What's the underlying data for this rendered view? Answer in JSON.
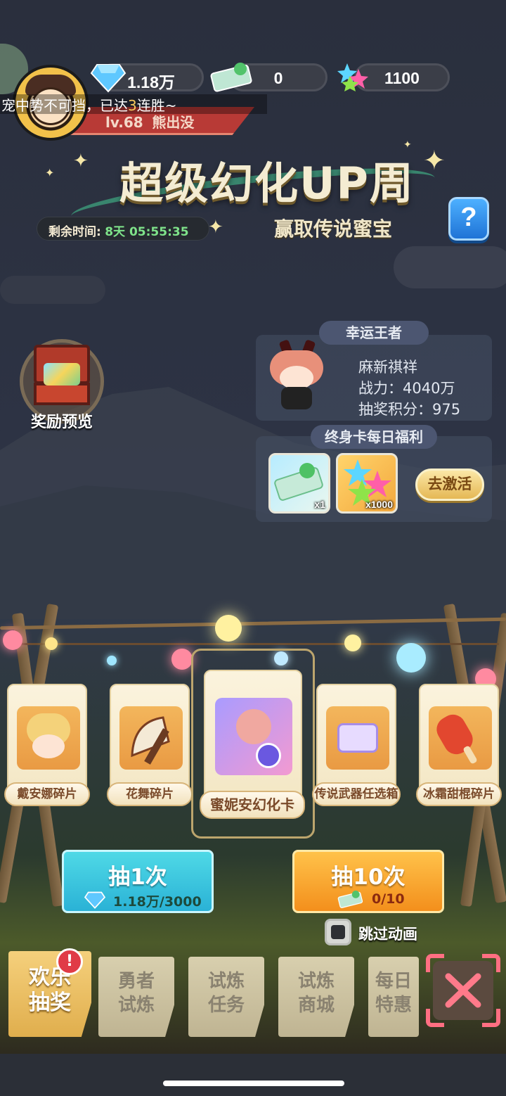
{
  "currency": {
    "diamonds": "1.18万",
    "tickets": "0",
    "stars": "1100"
  },
  "marquee": {
    "pre": "宠中势不可挡，已达",
    "count": "3",
    "post": "连胜~"
  },
  "player": {
    "level": "lv.68",
    "name": "熊出没"
  },
  "event": {
    "title": "超级幻化UP周",
    "subtitle": "赢取传说蜜宝",
    "timer_label": "剩余时间:",
    "timer_value": "8天 05:55:35",
    "help_label": "?"
  },
  "reward_preview": {
    "label": "奖励预览"
  },
  "lucky_king": {
    "tag": "幸运王者",
    "name": "麻新祺祥",
    "power": "战力：4040万",
    "score": "抽奖积分：975"
  },
  "lifetime_card": {
    "tag": "终身卡每日福利",
    "items": [
      {
        "icon": "super-ticket-icon",
        "qty": "x1"
      },
      {
        "icon": "stars-icon",
        "qty": "x1000"
      }
    ],
    "activate_label": "去激活"
  },
  "prize_cards": [
    {
      "label": "戴安娜碎片",
      "icon": "diana-fragment-icon"
    },
    {
      "label": "花舞碎片",
      "icon": "fan-fragment-icon"
    },
    {
      "label": "蜜妮安幻化卡",
      "icon": "transform-card-icon"
    },
    {
      "label": "传说武器任选箱",
      "icon": "weapon-chest-icon"
    },
    {
      "label": "冰霜甜棍碎片",
      "icon": "popsicle-fragment-icon"
    }
  ],
  "draw": {
    "single": {
      "label": "抽1次",
      "cost": "1.18万/3000"
    },
    "ten": {
      "label": "抽10次",
      "cost": "0/10"
    },
    "skip_label": "跳过动画"
  },
  "tabs": [
    {
      "label": "欢乐\n抽奖",
      "active": true
    },
    {
      "label": "勇者\n试炼",
      "active": false
    },
    {
      "label": "试炼\n任务",
      "active": false
    },
    {
      "label": "试炼\n商城",
      "active": false
    },
    {
      "label": "每日\n特惠",
      "active": false
    }
  ],
  "tab_badge": "!",
  "colors": {
    "accent_gold": "#e0ae4d",
    "timer_green": "#7fe38a",
    "single_draw": "#3ec9d8",
    "ten_draw": "#f5a623",
    "close_red": "#ff6f82"
  }
}
